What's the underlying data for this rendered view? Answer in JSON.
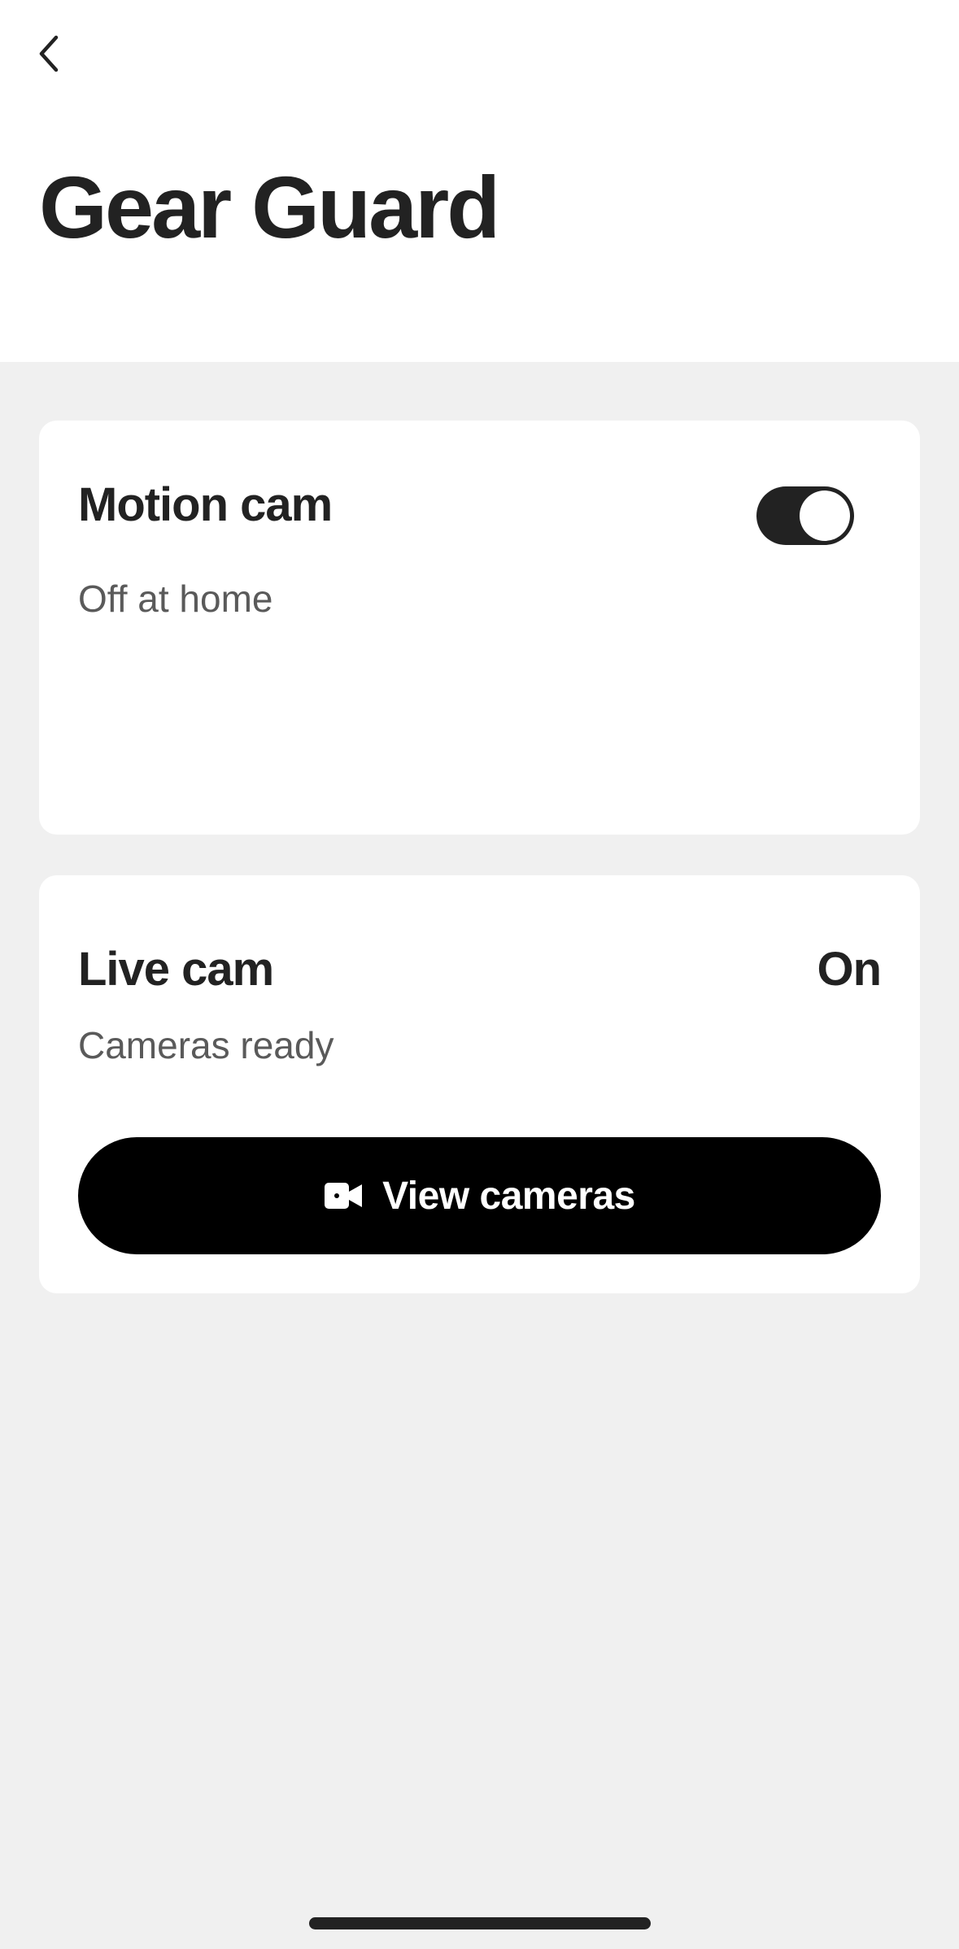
{
  "header": {
    "title": "Gear Guard",
    "back_icon": "chevron-left-icon"
  },
  "motion_cam": {
    "title": "Motion cam",
    "subtitle": "Off at home",
    "toggle_on": true,
    "toggle_color": "#222222"
  },
  "live_cam": {
    "title": "Live cam",
    "status": "On",
    "subtitle": "Cameras ready",
    "button_label": "View cameras",
    "button_icon": "video-camera-icon",
    "button_color": "#000000"
  },
  "colors": {
    "background": "#f0f0f0",
    "card": "#ffffff",
    "text_primary": "#222222",
    "text_secondary": "#5a5a5a"
  }
}
